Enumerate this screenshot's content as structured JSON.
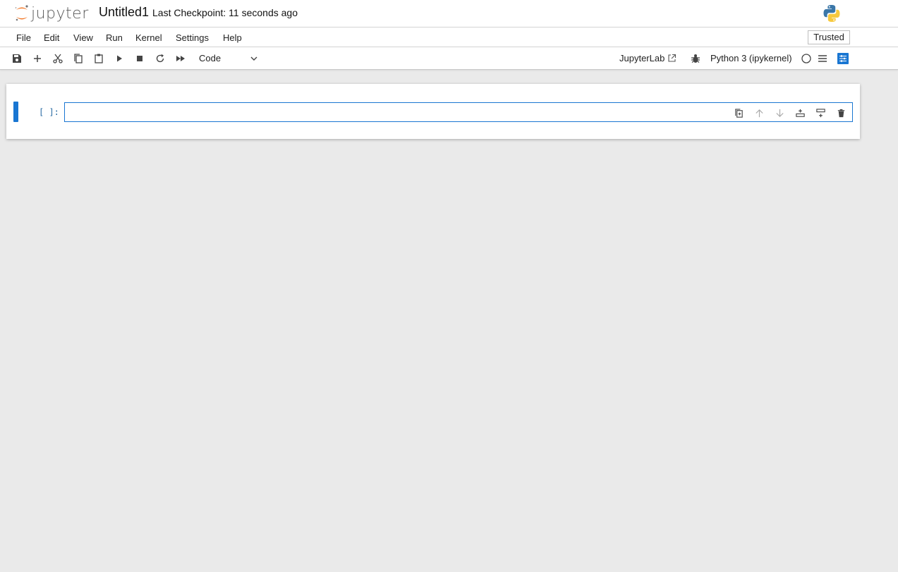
{
  "header": {
    "logo_text": "jupyter",
    "notebook_title": "Untitled1",
    "checkpoint": "Last Checkpoint: 11 seconds ago"
  },
  "menu": {
    "items": [
      "File",
      "Edit",
      "View",
      "Run",
      "Kernel",
      "Settings",
      "Help"
    ],
    "trusted": "Trusted"
  },
  "toolbar": {
    "icons": [
      "save-icon",
      "add-cell-icon",
      "cut-icon",
      "copy-icon",
      "paste-icon",
      "run-icon",
      "stop-icon",
      "restart-icon",
      "fast-forward-icon"
    ],
    "cell_type": "Code",
    "jupyterlab_link": "JupyterLab",
    "kernel_name": "Python 3 (ipykernel)",
    "kernel_status": "idle"
  },
  "cell": {
    "prompt": "[ ]:",
    "source": "",
    "tools": [
      "duplicate-icon",
      "move-up-icon",
      "move-down-icon",
      "insert-above-icon",
      "insert-below-icon",
      "delete-icon"
    ]
  },
  "colors": {
    "accent": "#1976d2",
    "jupyter_orange": "#f37726",
    "background": "#eaeaea",
    "prompt": "#2b6ca3"
  }
}
